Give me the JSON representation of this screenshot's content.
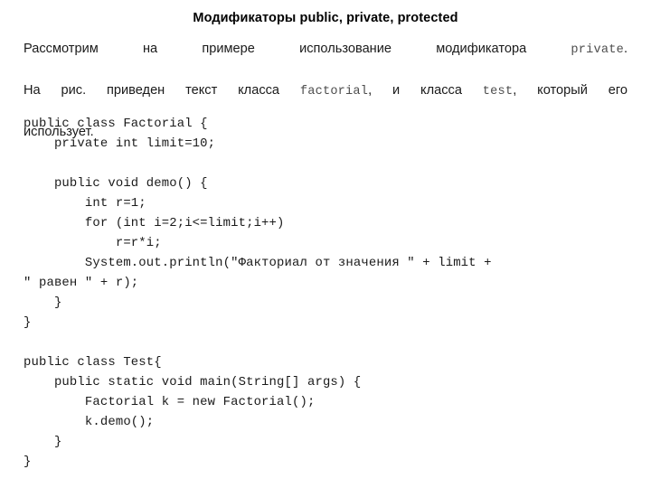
{
  "slide": {
    "title": "Модификаторы public, private, protected",
    "background_color": "#ffffff",
    "text_color": "#1a1a1a",
    "code_color": "#4d4d4d"
  },
  "intro": {
    "line1_part1": "Рассмотрим на примере использование модификатора ",
    "line1_code": "private",
    "line1_part2": ".",
    "line2_part1": "На рис. приведен текст класса ",
    "line2_code1": "factorial",
    "line2_part2": ", и класса ",
    "line2_code2": "test",
    "line2_part3": ", который его",
    "line3": "использует."
  },
  "code": {
    "lines": [
      "public class Factorial {",
      "    private int limit=10;",
      "",
      "    public void demo() {",
      "        int r=1;",
      "        for (int i=2;i<=limit;i++)",
      "            r=r*i;",
      "        System.out.println(\"Факториал от значения \" + limit +",
      "\" равен \" + r);",
      "    }",
      "}",
      "",
      "public class Test{",
      "    public static void main(String[] args) {",
      "        Factorial k = new Factorial();",
      "        k.demo();",
      "    }",
      "}"
    ]
  }
}
